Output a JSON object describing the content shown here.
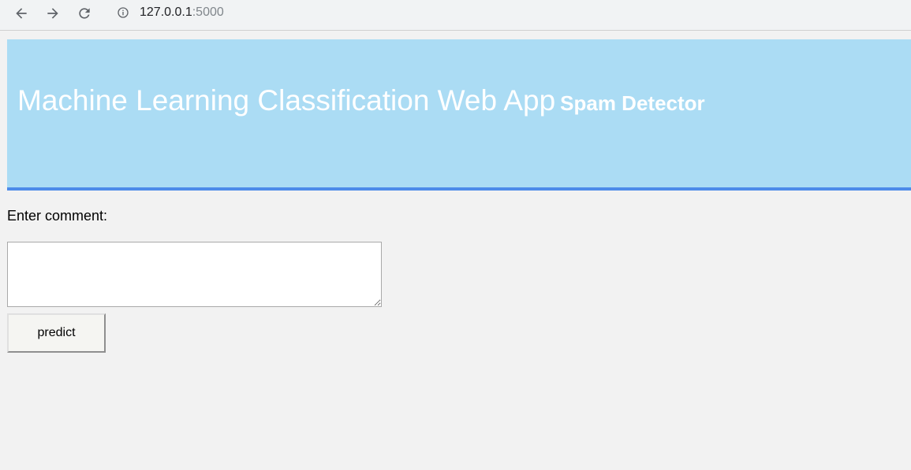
{
  "browser": {
    "url_host": "127.0.0.1",
    "url_port": ":5000"
  },
  "header": {
    "title": "Machine Learning Classification Web App",
    "subtitle": "Spam Detector",
    "background_color": "#abdcf4",
    "border_color": "#4c8be9"
  },
  "form": {
    "comment_label": "Enter comment:",
    "comment_value": "",
    "predict_label": "predict"
  }
}
